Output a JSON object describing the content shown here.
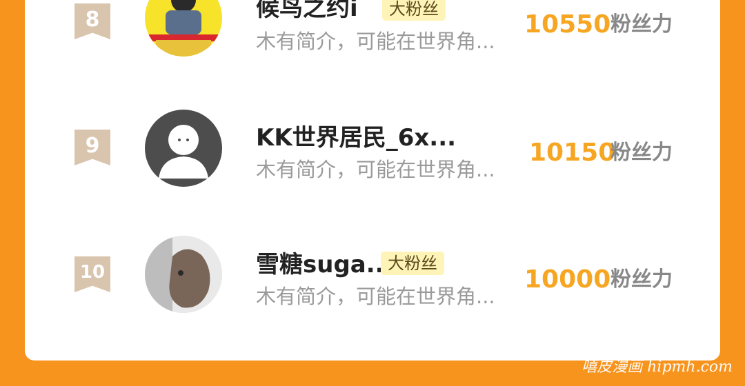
{
  "rows": [
    {
      "rank": "8",
      "name": "候鸟之约i",
      "badge": "大粉丝",
      "bio": "木有简介，可能在世界角...",
      "score": "10550",
      "unit": "粉丝力"
    },
    {
      "rank": "9",
      "name": "KK世界居民_6x...",
      "badge": "",
      "bio": "木有简介，可能在世界角...",
      "score": "10150",
      "unit": "粉丝力"
    },
    {
      "rank": "10",
      "name": "雪糖suga...",
      "badge": "大粉丝",
      "bio": "木有简介，可能在世界角...",
      "score": "10000",
      "unit": "粉丝力"
    }
  ],
  "watermark": "嘻皮漫画 hipmh.com",
  "colors": {
    "background": "#f7941d",
    "score": "#f6a623",
    "rank_badge": "#d9c4ae",
    "fan_badge": "#fff4b8"
  }
}
